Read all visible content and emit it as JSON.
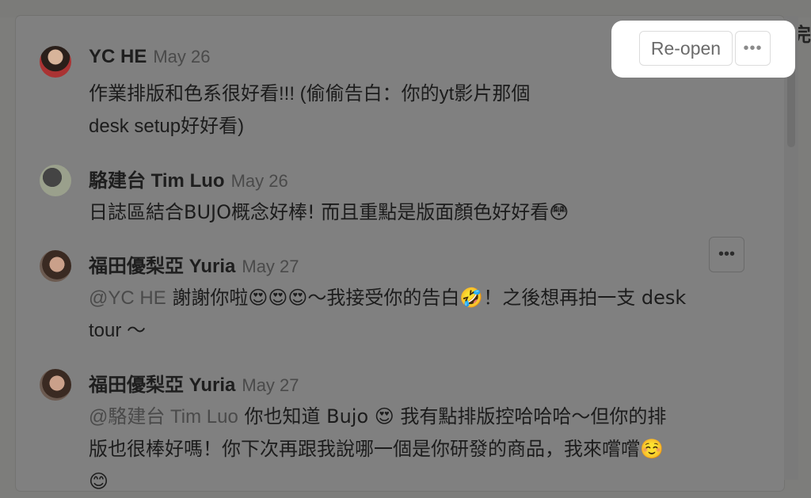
{
  "background": {
    "truncated_text_right": "完"
  },
  "header_actions": {
    "reopen_label": "Re-open",
    "more_label": "•••"
  },
  "comment_more_label": "•••",
  "comments": [
    {
      "author": "YC HE",
      "date": "May 26",
      "lines": [
        "作業排版和色系很好看!!! (偷偷告白：你的yt影片那個",
        "desk setup好好看)"
      ]
    },
    {
      "author": "駱建台 Tim Luo",
      "date": "May 26",
      "text": "日誌區結合BUJO概念好棒! 而且重點是版面顏色好好看😳"
    },
    {
      "author": "福田優梨亞 Yuria",
      "date": "May 27",
      "mention": "@YC HE",
      "lines": [
        " 謝謝你啦😍😍😍～我接受你的告白🤣！之後想再拍一支 desk",
        "tour ～"
      ]
    },
    {
      "author": "福田優梨亞 Yuria",
      "date": "May 27",
      "mention": "@駱建台 Tim Luo",
      "lines": [
        " 你也知道 Bujo 😍 我有點排版控哈哈哈～但你的排",
        "版也很棒好嗎！你下次再跟我說哪一個是你研發的商品，我來嚐嚐☺️",
        "😊"
      ]
    }
  ]
}
